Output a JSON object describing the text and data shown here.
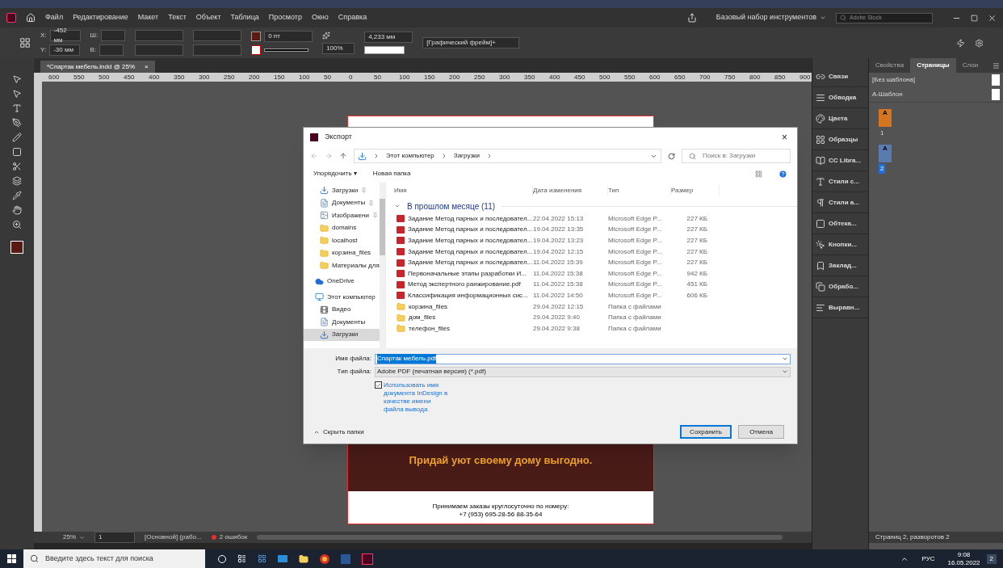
{
  "menu": {
    "items": [
      "Файл",
      "Редактирование",
      "Макет",
      "Текст",
      "Объект",
      "Таблица",
      "Просмотр",
      "Окно",
      "Справка"
    ],
    "workspace": "Базовый набор инструментов",
    "stock_search": {
      "placeholder": "Adobe Stock"
    }
  },
  "control_bar": {
    "x_label": "X:",
    "x": "-452 мм",
    "y_label": "Y:",
    "y": "-30 мм",
    "w_label": "Ш:",
    "h_label": "В:",
    "stroke": "0 пт",
    "scale": "100%",
    "spacing": "4,233 мм",
    "object_style": "[Графический фрейм]+"
  },
  "document_tab": {
    "title": "*Спартак мебель.indd @ 25%",
    "close": "×"
  },
  "ruler": [
    "600",
    "550",
    "500",
    "450",
    "400",
    "350",
    "300",
    "250",
    "200",
    "150",
    "100",
    "50",
    "0",
    "50",
    "100",
    "150",
    "200",
    "250",
    "300",
    "350",
    "400",
    "450",
    "500",
    "550",
    "600",
    "650",
    "700",
    "750",
    "800",
    "850",
    "900"
  ],
  "page": {
    "headline": "Придай уют своему дому выгодно.",
    "contact": "Принимаем заказы круглосуточно по номеру:",
    "phone": "+7 (953) 695-28-56  88-35-64"
  },
  "status_bar": {
    "zoom": "25%",
    "page": "1",
    "style": "[Основной] (рабо...",
    "errors": "2 ошибок"
  },
  "dialog": {
    "title": "Экспорт",
    "close": "×",
    "path": [
      "Этот компьютер",
      "Загрузки"
    ],
    "search": {
      "placeholder": "Поиск в: Загрузки"
    },
    "organize": "Упорядочить ▾",
    "new_folder": "Новая папка",
    "nav": [
      {
        "label": "Загрузки",
        "kind": "download",
        "pinned": true,
        "selected": false
      },
      {
        "label": "Документы",
        "kind": "document",
        "pinned": true,
        "selected": false
      },
      {
        "label": "Изображени",
        "kind": "image",
        "pinned": true,
        "selected": false
      },
      {
        "label": "domains",
        "kind": "folder",
        "pinned": false,
        "selected": false
      },
      {
        "label": "localhost",
        "kind": "folder",
        "pinned": false,
        "selected": false
      },
      {
        "label": "корзина_files",
        "kind": "folder",
        "pinned": false,
        "selected": false
      },
      {
        "label": "Материалы для",
        "kind": "folder",
        "pinned": false,
        "selected": false
      },
      {
        "label": "OneDrive",
        "kind": "cloud",
        "pinned": false,
        "selected": false
      },
      {
        "label": "Этот компьютер",
        "kind": "computer",
        "pinned": false,
        "selected": false
      },
      {
        "label": "Видео",
        "kind": "video",
        "pinned": false,
        "selected": false
      },
      {
        "label": "Документы",
        "kind": "document",
        "pinned": false,
        "selected": false
      },
      {
        "label": "Загрузки",
        "kind": "download",
        "pinned": false,
        "selected": true
      }
    ],
    "columns": [
      "Имя",
      "Дата изменения",
      "Тип",
      "Размер"
    ],
    "group": "В прошлом месяце (11)",
    "files": [
      {
        "name": "Задание Метод парных и последовател...",
        "date": "22.04.2022 15:13",
        "type": "Microsoft Edge P...",
        "size": "227 КБ",
        "kind": "pdf"
      },
      {
        "name": "Задание Метод парных и последовател...",
        "date": "19.04.2022 13:35",
        "type": "Microsoft Edge P...",
        "size": "227 КБ",
        "kind": "pdf"
      },
      {
        "name": "Задание Метод парных и последовател...",
        "date": "19.04.2022 13:23",
        "type": "Microsoft Edge P...",
        "size": "227 КБ",
        "kind": "pdf"
      },
      {
        "name": "Задание Метод парных и последовател...",
        "date": "19.04.2022 12:15",
        "type": "Microsoft Edge P...",
        "size": "227 КБ",
        "kind": "pdf"
      },
      {
        "name": "Задание Метод парных и последовател...",
        "date": "11.04.2022 15:39",
        "type": "Microsoft Edge P...",
        "size": "227 КБ",
        "kind": "pdf"
      },
      {
        "name": "Первоначальные этапы разработки И...",
        "date": "11.04.2022 15:38",
        "type": "Microsoft Edge P...",
        "size": "942 КБ",
        "kind": "pdf"
      },
      {
        "name": "Метод экспертного ранжирование.pdf",
        "date": "11.04.2022 15:38",
        "type": "Microsoft Edge P...",
        "size": "451 КБ",
        "kind": "pdf"
      },
      {
        "name": "Классификация информационных сис...",
        "date": "11.04.2022 14:50",
        "type": "Microsoft Edge P...",
        "size": "606 КБ",
        "kind": "pdf"
      },
      {
        "name": "корзина_files",
        "date": "29.04.2022 12:15",
        "type": "Папка с файлами",
        "kind": "folder"
      },
      {
        "name": "дом_files",
        "date": "29.04.2022 9:40",
        "type": "Папка с файлами",
        "kind": "folder"
      },
      {
        "name": "телефон_files",
        "date": "29.04.2022 9:38",
        "type": "Папка с файлами",
        "kind": "folder"
      }
    ],
    "filename_label": "Имя файла:",
    "filename": "Спартак мебель.pdf",
    "filetype_label": "Тип файла:",
    "filetype": "Adobe PDF (печатная версия) (*.pdf)",
    "use_doc_name": {
      "label": "Использовать имя документа InDesign в качестве имени файла вывода",
      "checked": true
    },
    "hide_folders": "Скрыть папки",
    "save": "Сохранить",
    "cancel": "Отмена"
  },
  "dock": [
    {
      "label": "Связи",
      "kind": "links"
    },
    {
      "label": "Обводка",
      "kind": "stroke"
    },
    {
      "label": "Цвета",
      "kind": "color"
    },
    {
      "label": "Образцы",
      "kind": "swatches"
    },
    {
      "label": "CC Libra...",
      "kind": "library"
    },
    {
      "label": "Стили с...",
      "kind": "charstyle"
    },
    {
      "label": "Стили а...",
      "kind": "parastyle"
    },
    {
      "label": "Обтека...",
      "kind": "wrap"
    },
    {
      "label": "Кнопки...",
      "kind": "buttons"
    },
    {
      "label": "Заклад...",
      "kind": "bookmark"
    },
    {
      "label": "Обрабо...",
      "kind": "pathfinder"
    },
    {
      "label": "Выравн...",
      "kind": "align"
    }
  ],
  "pages_panel": {
    "tabs": [
      {
        "label": "Свойства",
        "selected": false
      },
      {
        "label": "Страницы",
        "selected": true
      },
      {
        "label": "Слои",
        "selected": false
      }
    ],
    "masters": [
      "[Без шаблона]",
      "А-Шаблон"
    ],
    "pages": [
      {
        "number": "1",
        "master": "A",
        "selected": false
      },
      {
        "number": "2",
        "master": "A",
        "selected": true
      }
    ],
    "footer": "Страниц 2, разворотов 2"
  },
  "taskbar": {
    "search": {
      "placeholder": "Введите здесь текст для поиска"
    },
    "language": "РУС",
    "time": "9:08",
    "date": "16.05.2022",
    "notifications": "2"
  }
}
